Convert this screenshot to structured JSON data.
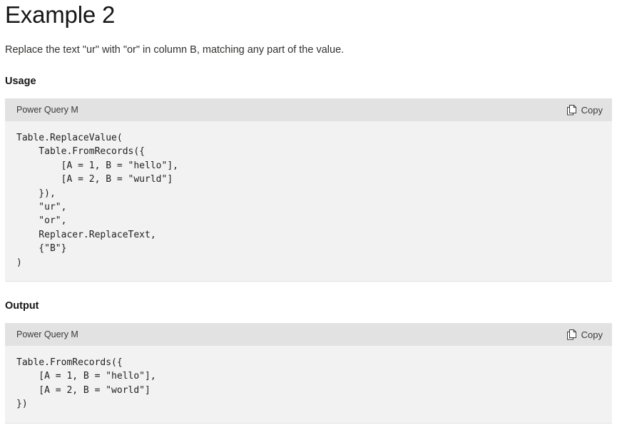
{
  "page": {
    "title": "Example 2",
    "intro": "Replace the text \"ur\" with \"or\" in column B, matching any part of the value."
  },
  "sections": [
    {
      "heading": "Usage",
      "code_block": {
        "language_label": "Power Query M",
        "copy_label": "Copy",
        "copy_icon": "copy-icon",
        "code": "Table.ReplaceValue(\n    Table.FromRecords({\n        [A = 1, B = \"hello\"],\n        [A = 2, B = \"wurld\"]\n    }),\n    \"ur\",\n    \"or\",\n    Replacer.ReplaceText,\n    {\"B\"}\n)"
      }
    },
    {
      "heading": "Output",
      "code_block": {
        "language_label": "Power Query M",
        "copy_label": "Copy",
        "copy_icon": "copy-icon",
        "code": "Table.FromRecords({\n    [A = 1, B = \"hello\"],\n    [A = 2, B = \"world\"]\n})"
      }
    }
  ],
  "colors": {
    "code_header_bg": "#e2e2e2",
    "code_body_bg": "#f2f2f2",
    "text": "#171717",
    "muted_text": "#3b3a39"
  }
}
